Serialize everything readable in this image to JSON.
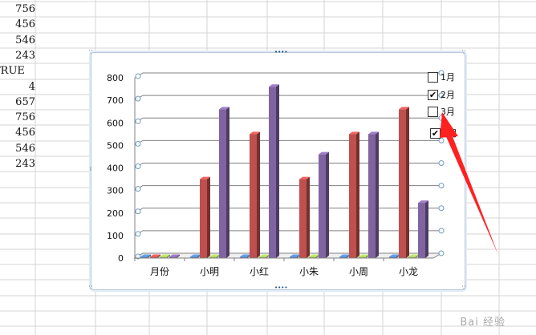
{
  "sheet": {
    "column_a_values": [
      "756",
      "456",
      "546",
      "243",
      "TRUE",
      "4",
      "657",
      "756",
      "456",
      "546",
      "243"
    ]
  },
  "chart_data": {
    "type": "bar",
    "categories": [
      "月份",
      "小明",
      "小红",
      "小朱",
      "小周",
      "小龙"
    ],
    "series": [
      {
        "name": "1月",
        "values": [
          0,
          0,
          0,
          0,
          0,
          0
        ],
        "color": "#4f81bd"
      },
      {
        "name": "2月",
        "values": [
          0,
          350,
          550,
          350,
          550,
          660
        ],
        "color": "#c0504d"
      },
      {
        "name": "3月",
        "values": [
          0,
          0,
          0,
          0,
          0,
          0
        ],
        "color": "#9bbb59"
      },
      {
        "name": "4月",
        "values": [
          4,
          660,
          760,
          460,
          550,
          245
        ],
        "color": "#8064a2"
      }
    ],
    "ylim": [
      0,
      800
    ],
    "yticks": [
      "0",
      "100",
      "200",
      "300",
      "400",
      "500",
      "600",
      "700",
      "800"
    ],
    "grid": true,
    "legend": "right",
    "colors": {
      "axis": "#808080",
      "grid": "#808080",
      "handle": "#6f9bc6"
    }
  },
  "legend": {
    "items": [
      {
        "label": "1月",
        "checked": false,
        "mark": ""
      },
      {
        "label": "2月",
        "checked": true,
        "mark": "✔"
      },
      {
        "label": "3月",
        "checked": false,
        "mark": ""
      },
      {
        "label": "4月",
        "checked": true,
        "mark": "✔"
      }
    ]
  },
  "annotation": {
    "arrow_color": "#ff2020"
  },
  "watermark": {
    "text": "Bai 经验"
  }
}
